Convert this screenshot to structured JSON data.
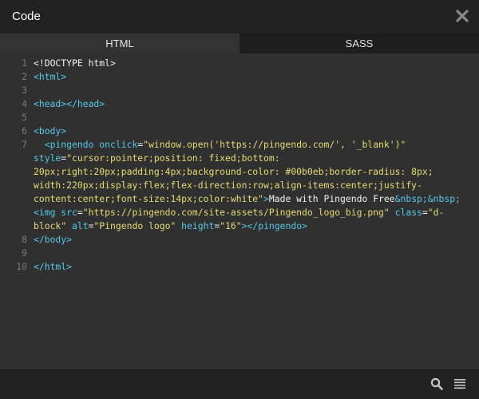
{
  "window": {
    "title": "Code",
    "close_icon": "close-icon"
  },
  "tabs": [
    {
      "label": "HTML",
      "active": true
    },
    {
      "label": "SASS",
      "active": false
    }
  ],
  "editor": {
    "lines": [
      {
        "num": "1",
        "segments": [
          {
            "text": "<!DOCTYPE html>",
            "cls": "txt"
          }
        ]
      },
      {
        "num": "2",
        "segments": [
          {
            "text": "<html>",
            "cls": "tag"
          }
        ]
      },
      {
        "num": "3",
        "segments": []
      },
      {
        "num": "4",
        "segments": [
          {
            "text": "<head></head>",
            "cls": "tag"
          }
        ]
      },
      {
        "num": "5",
        "segments": []
      },
      {
        "num": "6",
        "segments": [
          {
            "text": "<body>",
            "cls": "tag"
          }
        ]
      },
      {
        "num": "7",
        "segments": [
          {
            "text": "  <pingendo ",
            "cls": "tag"
          },
          {
            "text": "onclick",
            "cls": "attr"
          },
          {
            "text": "=",
            "cls": "txt"
          },
          {
            "text": "\"window.open('https://pingendo.com/', '_blank')\"",
            "cls": "str"
          },
          {
            "text": " style",
            "cls": "attr"
          },
          {
            "text": "=",
            "cls": "txt"
          },
          {
            "text": "\"cursor:pointer;position: fixed;bottom: 20px;right:20px;padding:4px;background-color: #00b0eb;border-radius: 8px; width:220px;display:flex;flex-direction:row;align-items:center;justify-content:center;font-size:14px;color:white\"",
            "cls": "str"
          },
          {
            "text": ">",
            "cls": "tag"
          },
          {
            "text": "Made with Pingendo Free",
            "cls": "txt"
          },
          {
            "text": "&nbsp;&nbsp;",
            "cls": "ent"
          },
          {
            "text": "<img ",
            "cls": "tag"
          },
          {
            "text": "src",
            "cls": "attr"
          },
          {
            "text": "=",
            "cls": "txt"
          },
          {
            "text": "\"https://pingendo.com/site-assets/Pingendo_logo_big.png\"",
            "cls": "str"
          },
          {
            "text": " class",
            "cls": "attr"
          },
          {
            "text": "=",
            "cls": "txt"
          },
          {
            "text": "\"d-block\"",
            "cls": "str"
          },
          {
            "text": " alt",
            "cls": "attr"
          },
          {
            "text": "=",
            "cls": "txt"
          },
          {
            "text": "\"Pingendo logo\"",
            "cls": "str"
          },
          {
            "text": " height",
            "cls": "attr"
          },
          {
            "text": "=",
            "cls": "txt"
          },
          {
            "text": "\"16\"",
            "cls": "str"
          },
          {
            "text": "></pingendo>",
            "cls": "tag"
          }
        ]
      },
      {
        "num": "8",
        "segments": [
          {
            "text": "</body>",
            "cls": "tag"
          }
        ]
      },
      {
        "num": "9",
        "segments": []
      },
      {
        "num": "10",
        "segments": [
          {
            "text": "</html>",
            "cls": "tag"
          }
        ]
      }
    ]
  },
  "footer": {
    "icons": [
      "search-icon",
      "menu-icon"
    ]
  },
  "colors": {
    "titlebar": "#222222",
    "editor_bg": "#303030",
    "tag": "#54c8e8",
    "string": "#e6db74",
    "line_number": "#7a7a7a"
  }
}
